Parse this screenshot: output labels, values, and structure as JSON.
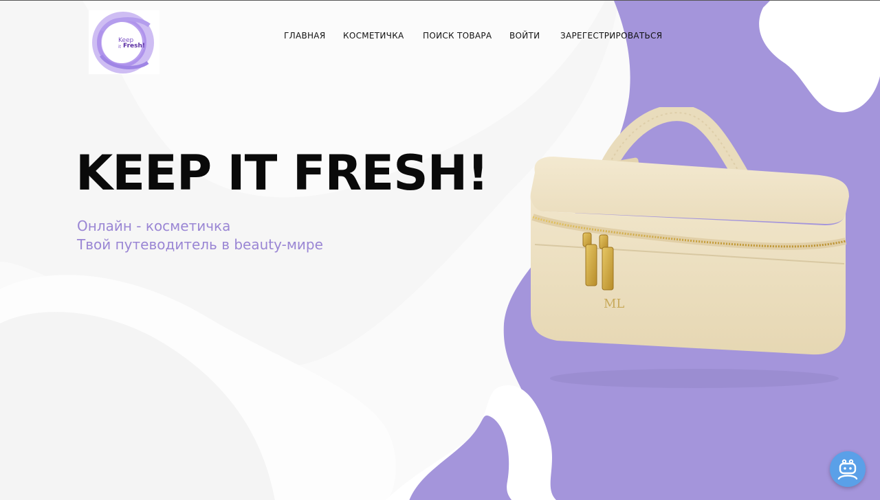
{
  "logo": {
    "line1": "Keep",
    "line2": "it",
    "line3": "Fresh!"
  },
  "nav": {
    "items": [
      {
        "label": "ГЛАВНАЯ"
      },
      {
        "label": "КОСМЕТИЧКА"
      },
      {
        "label": "ПОИСК ТОВАРА"
      },
      {
        "label": "ВОЙТИ"
      },
      {
        "label": "ЗАРЕГЕСТРИРОВАТЬСЯ"
      }
    ]
  },
  "hero": {
    "title": "KEEP IT FRESH!",
    "subtitle_line1": "Онлайн - косметичка",
    "subtitle_line2": "Твой путеводитель в beauty-мире"
  },
  "product_image": {
    "monogram": "ML"
  },
  "colors": {
    "accent_purple": "#a495db",
    "subtitle_purple": "#9a86d4",
    "bag_cream": "#efe3c6",
    "zipper_gold": "#c9a23c",
    "bot_blue": "#5aa0e8"
  },
  "icons": {
    "chat_bot": "robot-icon"
  }
}
